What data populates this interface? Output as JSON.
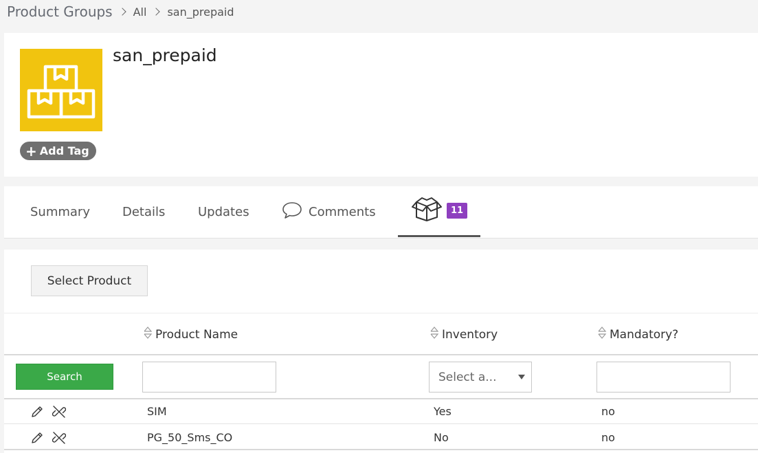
{
  "breadcrumb": {
    "root": "Product Groups",
    "items": [
      "All",
      "san_prepaid"
    ]
  },
  "record": {
    "title": "san_prepaid",
    "icon": "package-boxes-icon",
    "icon_color": "#f1c40f",
    "add_tag_label": "Add Tag"
  },
  "tabs": [
    {
      "label": "Summary"
    },
    {
      "label": "Details"
    },
    {
      "label": "Updates"
    },
    {
      "label": "Comments",
      "icon": "comment-icon"
    },
    {
      "icon": "box-icon",
      "badge": "11",
      "active": true
    }
  ],
  "badge_color": "#8e3fbf",
  "toolbar": {
    "select_product_label": "Select Product"
  },
  "table": {
    "columns": [
      "Product Name",
      "Inventory",
      "Mandatory?"
    ],
    "search_label": "Search",
    "search_color": "#3aa948",
    "inventory_filter_value": "Select a...",
    "rows": [
      {
        "name": "SIM",
        "inventory": "Yes",
        "mandatory": "no"
      },
      {
        "name": "PG_50_Sms_CO",
        "inventory": "No",
        "mandatory": "no"
      }
    ]
  }
}
